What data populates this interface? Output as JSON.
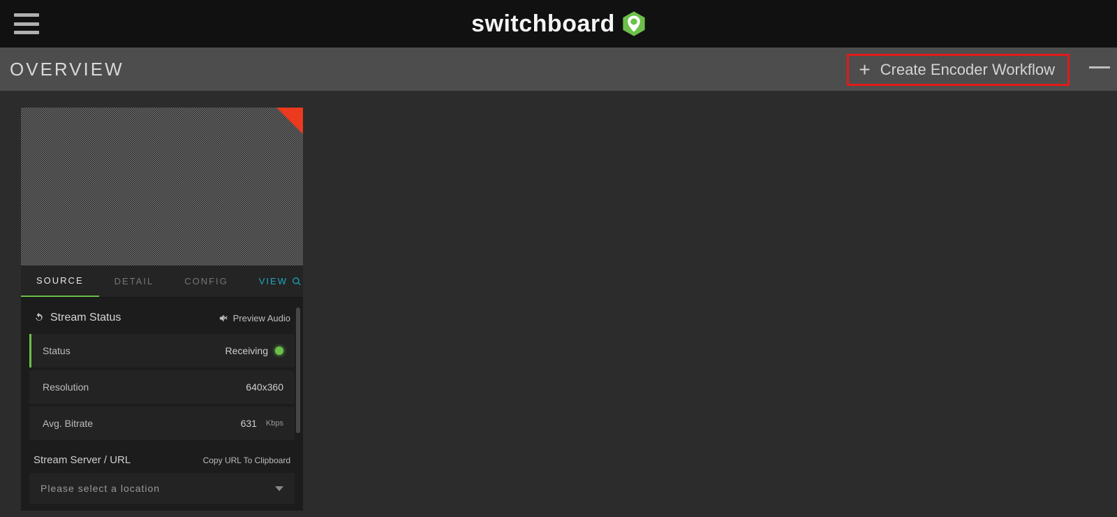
{
  "brand": {
    "name": "switchboard"
  },
  "overview": {
    "title": "OVERVIEW",
    "create_label": "Create Encoder Workflow"
  },
  "card": {
    "tabs": {
      "source": "SOURCE",
      "detail": "DETAIL",
      "config": "CONFIG",
      "view": "VIEW"
    },
    "stream_status": {
      "heading": "Stream Status",
      "preview_audio": "Preview Audio",
      "rows": {
        "status": {
          "label": "Status",
          "value": "Receiving"
        },
        "resolution": {
          "label": "Resolution",
          "value": "640x360"
        },
        "bitrate": {
          "label": "Avg. Bitrate",
          "value": "631",
          "unit": "Kbps"
        }
      }
    },
    "stream_server": {
      "heading": "Stream Server / URL",
      "copy_action": "Copy URL To Clipboard",
      "select_placeholder": "Please select a location"
    }
  }
}
